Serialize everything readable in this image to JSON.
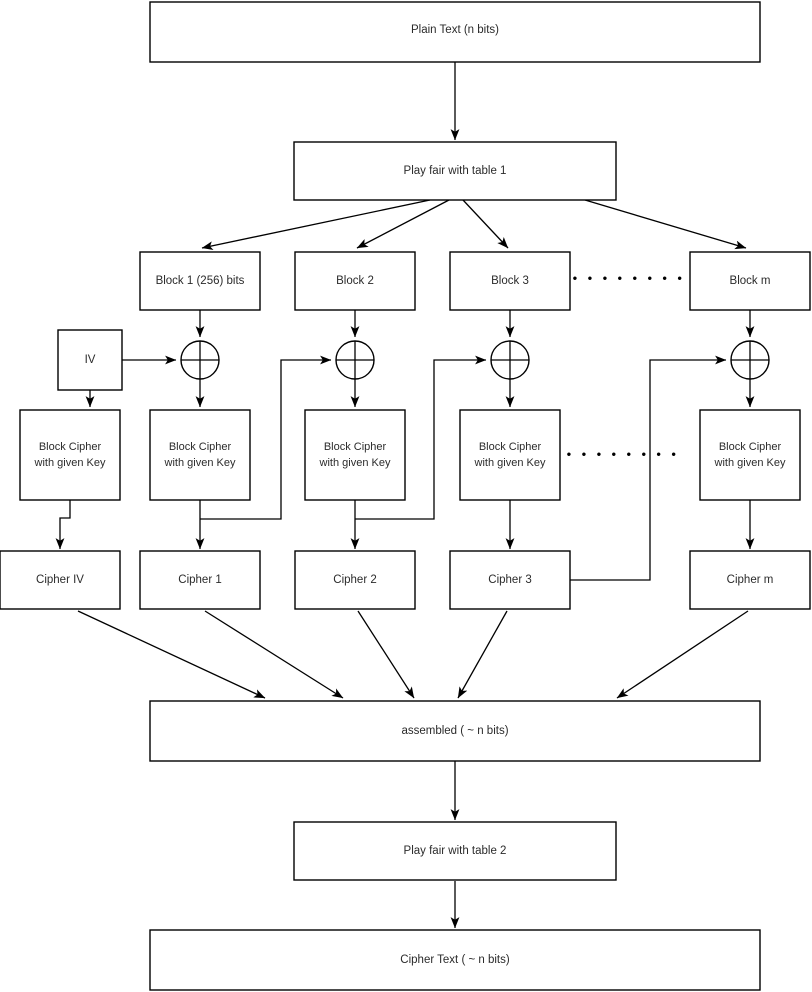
{
  "diagram": {
    "title": "Block cipher encryption flow with Playfair pre/post processing",
    "colors": {
      "background": "#ffffff",
      "stroke": "#000000",
      "text": "#2b2b2b"
    },
    "nodes": {
      "plain_text": "Plain Text (n bits)",
      "playfair_1": "Play fair with table 1",
      "block_1": "Block 1 (256) bits",
      "block_2": "Block 2",
      "block_3": "Block 3",
      "block_m": "Block m",
      "iv": "IV",
      "block_cipher_iv_line1": "Block Cipher",
      "block_cipher_iv_line2": "with given Key",
      "block_cipher_1_line1": "Block Cipher",
      "block_cipher_1_line2": "with given Key",
      "block_cipher_2_line1": "Block Cipher",
      "block_cipher_2_line2": "with given Key",
      "block_cipher_3_line1": "Block Cipher",
      "block_cipher_3_line2": "with given Key",
      "block_cipher_m_line1": "Block Cipher",
      "block_cipher_m_line2": "with given Key",
      "cipher_iv": "Cipher IV",
      "cipher_1": "Cipher 1",
      "cipher_2": "Cipher 2",
      "cipher_3": "Cipher 3",
      "cipher_m": "Cipher m",
      "assembled": "assembled ( ~ n bits)",
      "playfair_2": "Play fair with table 2",
      "cipher_text": "Cipher Text ( ~ n bits)"
    },
    "ellipsis": {
      "blocks_row": "• • • • • • • •",
      "ciphers_row": "• • • • • • • •"
    },
    "xor_symbols": {
      "xor_1": "xor-operator",
      "xor_2": "xor-operator",
      "xor_3": "xor-operator",
      "xor_m": "xor-operator"
    }
  }
}
